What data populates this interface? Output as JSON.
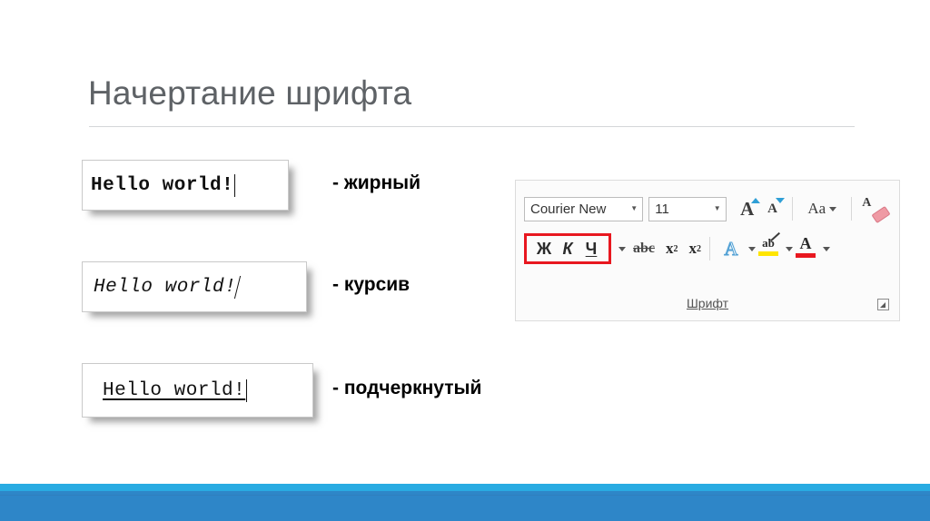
{
  "slide": {
    "title": "Начертание шрифта",
    "title_color": "#5e6266",
    "accent_light": "#29abe2",
    "accent_dark": "#2e86c8"
  },
  "samples": [
    {
      "text": "Hello world!",
      "label": "- жирный",
      "style": "bold"
    },
    {
      "text": "Hello world!",
      "label": "- курсив",
      "style": "italic"
    },
    {
      "text": "Hello world!",
      "label": "- подчеркнутый",
      "style": "underline"
    }
  ],
  "ribbon": {
    "group_label": "Шрифт",
    "font_name": "Courier New",
    "font_size": "11",
    "dropdown_arrow": "▼",
    "grow_font_icon": "A",
    "shrink_font_icon": "A",
    "change_case_label": "Aa",
    "clear_formatting_icon": "A",
    "bold_label": "Ж",
    "italic_label": "К",
    "underline_label": "Ч",
    "strikethrough_label": "abc",
    "subscript_base": "x",
    "subscript_index": "2",
    "superscript_base": "x",
    "superscript_index": "2",
    "text_effects_label": "A",
    "highlight_label": "ab",
    "font_color_label": "A",
    "highlight_color": "#ffe500",
    "font_color": "#e8171f",
    "selection_outline_color": "#e8171f"
  }
}
